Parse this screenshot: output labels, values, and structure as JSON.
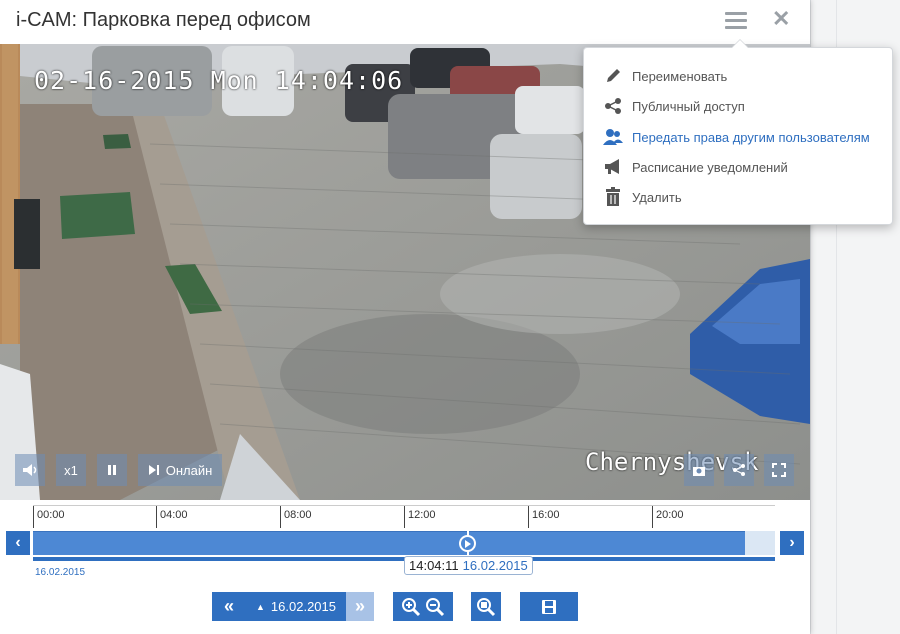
{
  "dialog": {
    "title": "i-CAM: Парковка перед офисом"
  },
  "video": {
    "osd_datetime": "02-16-2015 Mon 14:04:06",
    "osd_camera": "Chernyshevsk",
    "controls": {
      "speed_label": "x1",
      "live_label": "Онлайн"
    }
  },
  "menu": {
    "items": [
      {
        "label": "Переименовать",
        "icon": "pencil-icon"
      },
      {
        "label": "Публичный доступ",
        "icon": "share-icon"
      },
      {
        "label": "Передать права другим пользователям",
        "icon": "users-icon"
      },
      {
        "label": "Расписание уведомлений",
        "icon": "megaphone-icon"
      },
      {
        "label": "Удалить",
        "icon": "trash-icon"
      }
    ]
  },
  "timeline": {
    "ticks": [
      "00:00",
      "04:00",
      "08:00",
      "12:00",
      "16:00",
      "20:00"
    ],
    "cursor_time": "14:04:11",
    "cursor_date": "16.02.2015",
    "day_label": "16.02.2015"
  },
  "toolbar": {
    "date_label": "16.02.2015"
  },
  "colors": {
    "accent": "#2f6fc0",
    "bar": "#4d88d4"
  }
}
